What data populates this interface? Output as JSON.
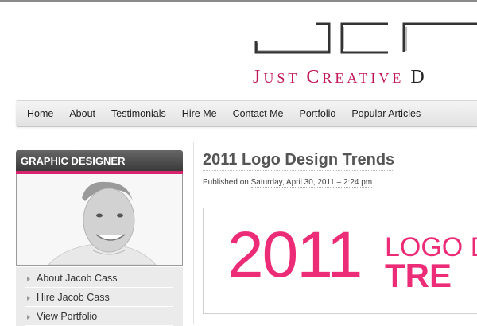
{
  "brand": {
    "tagline_j": "J",
    "tagline_ust": "UST",
    "tagline_c": "C",
    "tagline_reative": "REATIVE",
    "tagline_d": "D",
    "accent_color": "#c2185b"
  },
  "nav": {
    "items": [
      {
        "label": "Home"
      },
      {
        "label": "About"
      },
      {
        "label": "Testimonials"
      },
      {
        "label": "Hire Me"
      },
      {
        "label": "Contact Me"
      },
      {
        "label": "Portfolio"
      },
      {
        "label": "Popular Articles"
      }
    ]
  },
  "sidebar": {
    "heading": "GRAPHIC DESIGNER",
    "links": [
      {
        "label": "About Jacob Cass"
      },
      {
        "label": "Hire Jacob Cass"
      },
      {
        "label": "View Portfolio"
      }
    ]
  },
  "post": {
    "title": "2011 Logo Design Trends",
    "meta_prefix": "Published on",
    "date": "Saturday, April 30, 2011 – 2:24 pm",
    "hero_year": "2011",
    "hero_word1": "LOGO D",
    "hero_word2": "TRE",
    "hero_color": "#ec2c77"
  }
}
